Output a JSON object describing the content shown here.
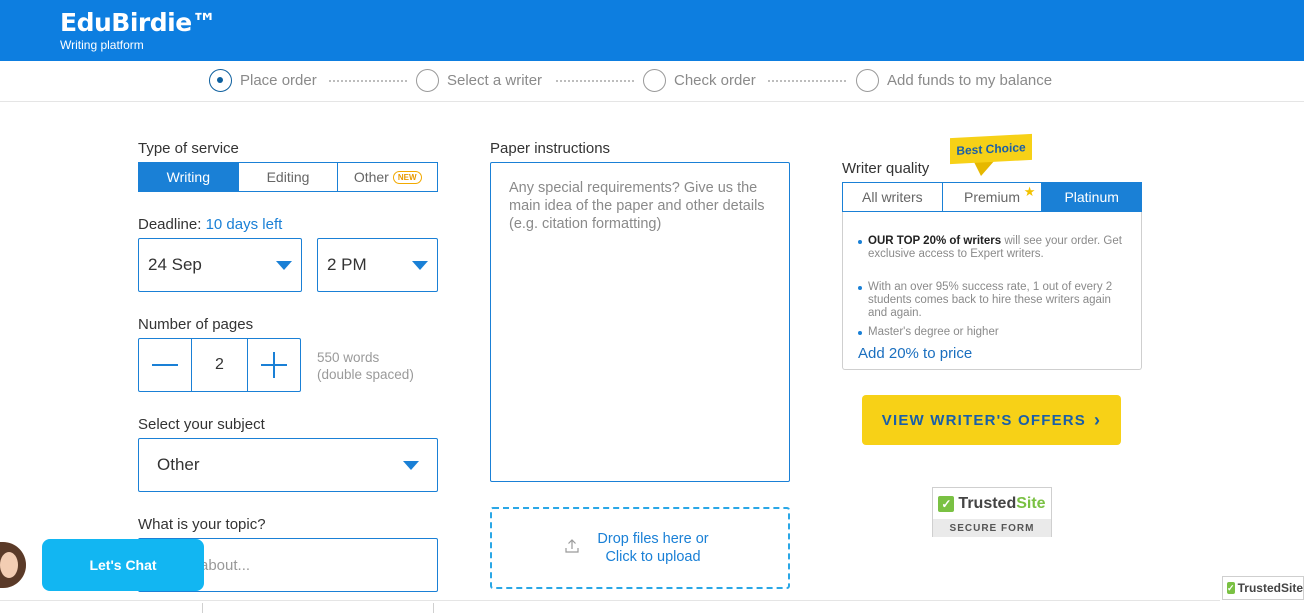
{
  "brand": {
    "name": "EduBirdie™",
    "tagline": "Writing platform"
  },
  "steps": [
    {
      "label": "Place order",
      "active": true
    },
    {
      "label": "Select a writer",
      "active": false
    },
    {
      "label": "Check order",
      "active": false
    },
    {
      "label": "Add funds to my balance",
      "active": false
    }
  ],
  "service": {
    "label": "Type of service",
    "options": [
      "Writing",
      "Editing",
      "Other"
    ],
    "selected": "Writing",
    "new_badge": "NEW"
  },
  "deadline": {
    "label": "Deadline:",
    "days_left": "10 days left",
    "date": "24 Sep",
    "time": "2 PM"
  },
  "pages": {
    "label": "Number of pages",
    "value": "2",
    "words_line1": "550 words",
    "words_line2": "(double spaced)"
  },
  "subject": {
    "label": "Select your subject",
    "value": "Other"
  },
  "topic": {
    "label": "What is your topic?",
    "placeholder": "about..."
  },
  "instructions": {
    "label": "Paper instructions",
    "placeholder": "Any special requirements? Give us the main idea of the paper and other details (e.g. citation formatting)"
  },
  "upload": {
    "line1": "Drop files here or",
    "line2": "Click to upload"
  },
  "writer_quality": {
    "label": "Writer quality",
    "ribbon": "Best Choice",
    "tabs": [
      "All writers",
      "Premium",
      "Platinum"
    ],
    "selected": "Platinum",
    "bullet1_bold": "OUR TOP 20% of writers",
    "bullet1_rest": " will see your order. Get exclusive access to Expert writers.",
    "bullet2": "With an over 95% success rate, 1 out of every 2 students comes back to hire these writers again and again.",
    "bullet3": "Master's degree or higher",
    "price_note": "Add 20% to price"
  },
  "cta": {
    "label": "VIEW WRITER'S OFFERS"
  },
  "trust": {
    "brand_a": "Trusted",
    "brand_b": "Site",
    "caption": "SECURE FORM",
    "mini": "TrustedSite"
  },
  "chat": {
    "label": "Let's Chat"
  },
  "colors": {
    "primary": "#0d7ee0",
    "accent_yellow": "#f7d117",
    "chat": "#12b6f2",
    "trust_green": "#7ac143"
  }
}
